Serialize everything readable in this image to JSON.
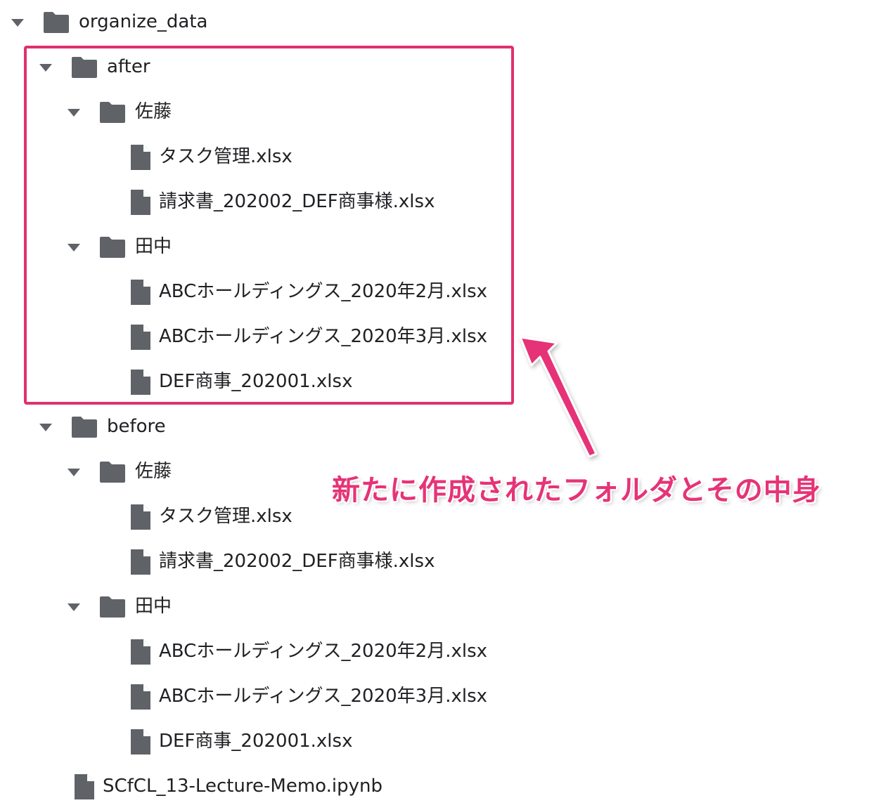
{
  "colors": {
    "icon": "#5f6368",
    "text": "#202124",
    "accent": "#e0306f"
  },
  "tree": [
    {
      "kind": "folder",
      "depth": 0,
      "label": "organize_data",
      "expanded": true,
      "icon": "folder-icon"
    },
    {
      "kind": "folder",
      "depth": 1,
      "label": "after",
      "expanded": true,
      "icon": "folder-icon"
    },
    {
      "kind": "folder",
      "depth": 2,
      "label": "佐藤",
      "expanded": true,
      "icon": "folder-icon"
    },
    {
      "kind": "file",
      "depth": 3,
      "label": "タスク管理.xlsx",
      "icon": "file-icon"
    },
    {
      "kind": "file",
      "depth": 3,
      "label": "請求書_202002_DEF商事様.xlsx",
      "icon": "file-icon"
    },
    {
      "kind": "folder",
      "depth": 2,
      "label": "田中",
      "expanded": true,
      "icon": "folder-icon"
    },
    {
      "kind": "file",
      "depth": 3,
      "label": "ABCホールディングス_2020年2月.xlsx",
      "icon": "file-icon"
    },
    {
      "kind": "file",
      "depth": 3,
      "label": "ABCホールディングス_2020年3月.xlsx",
      "icon": "file-icon"
    },
    {
      "kind": "file",
      "depth": 3,
      "label": "DEF商事_202001.xlsx",
      "icon": "file-icon"
    },
    {
      "kind": "folder",
      "depth": 1,
      "label": "before",
      "expanded": true,
      "icon": "folder-icon"
    },
    {
      "kind": "folder",
      "depth": 2,
      "label": "佐藤",
      "expanded": true,
      "icon": "folder-icon"
    },
    {
      "kind": "file",
      "depth": 3,
      "label": "タスク管理.xlsx",
      "icon": "file-icon"
    },
    {
      "kind": "file",
      "depth": 3,
      "label": "請求書_202002_DEF商事様.xlsx",
      "icon": "file-icon"
    },
    {
      "kind": "folder",
      "depth": 2,
      "label": "田中",
      "expanded": true,
      "icon": "folder-icon"
    },
    {
      "kind": "file",
      "depth": 3,
      "label": "ABCホールディングス_2020年2月.xlsx",
      "icon": "file-icon"
    },
    {
      "kind": "file",
      "depth": 3,
      "label": "ABCホールディングス_2020年3月.xlsx",
      "icon": "file-icon"
    },
    {
      "kind": "file",
      "depth": 3,
      "label": "DEF商事_202001.xlsx",
      "icon": "file-icon"
    },
    {
      "kind": "file",
      "depth": 1,
      "label": "SCfCL_13-Lecture-Memo.ipynb",
      "icon": "file-icon"
    }
  ],
  "annotation": {
    "text": "新たに作成されたフォルダとその中身",
    "arrow_icon": "pointer-arrow-icon"
  }
}
